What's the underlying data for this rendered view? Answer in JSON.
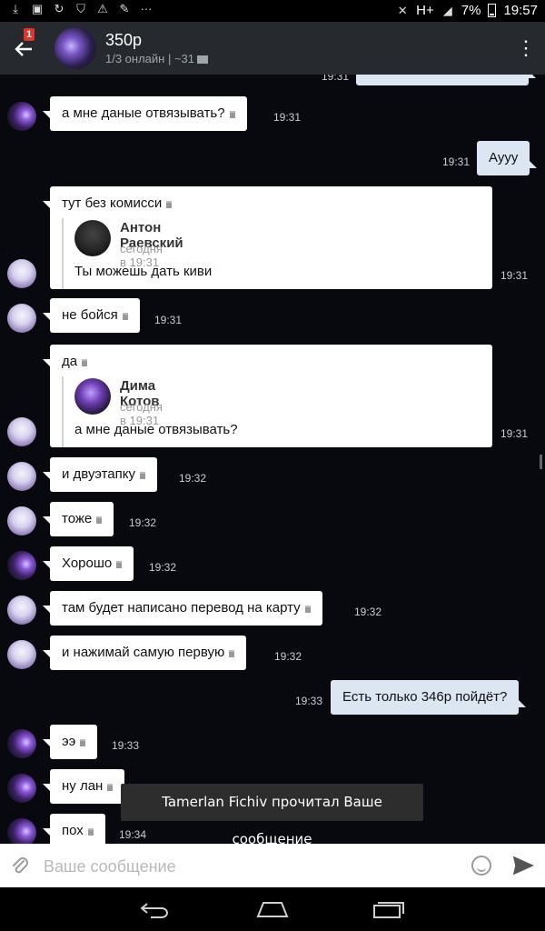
{
  "status_bar": {
    "network": "H+",
    "battery": "7%",
    "time": "19:57"
  },
  "header": {
    "title": "350р",
    "subtitle": "1/3 онлайн | ~31",
    "back_badge": "1"
  },
  "messages": [
    {
      "text": "а мне даные отвязывать?",
      "time": "19:31",
      "dir": "in"
    },
    {
      "text": "Аууу",
      "time": "19:31",
      "dir": "out"
    },
    {
      "text": "тут без комисси",
      "time": "19:31",
      "dir": "in",
      "quote": {
        "name": "Антон Раевский",
        "date": "сегодня в 19:31",
        "text": "Ты можешь дать киви"
      }
    },
    {
      "text": "не бойся",
      "time": "19:31",
      "dir": "in"
    },
    {
      "text": "да",
      "time": "19:31",
      "dir": "in",
      "quote": {
        "name": "Дима Котов",
        "date": "сегодня в 19:31",
        "text": "а мне даные отвязывать?"
      }
    },
    {
      "text": "и двуэтапку",
      "time": "19:32",
      "dir": "in"
    },
    {
      "text": "тоже",
      "time": "19:32",
      "dir": "in"
    },
    {
      "text": "Хорошо",
      "time": "19:32",
      "dir": "in"
    },
    {
      "text": "там будет написано перевод на карту",
      "time": "19:32",
      "dir": "in"
    },
    {
      "text": "и нажимай самую первую",
      "time": "19:32",
      "dir": "in"
    },
    {
      "text": "Есть только 346р пойдёт?",
      "time": "19:33",
      "dir": "out"
    },
    {
      "text": "ээ",
      "time": "19:33",
      "dir": "in"
    },
    {
      "text": "ну лан",
      "time": "",
      "dir": "in"
    },
    {
      "text": "пох",
      "time": "19:34",
      "dir": "in"
    }
  ],
  "top_partial_time": "19:31",
  "toast": "Tamerlan Fichiv прочитал Ваше сообщение",
  "composer": {
    "placeholder": "Ваше сообщение",
    "value": ""
  }
}
